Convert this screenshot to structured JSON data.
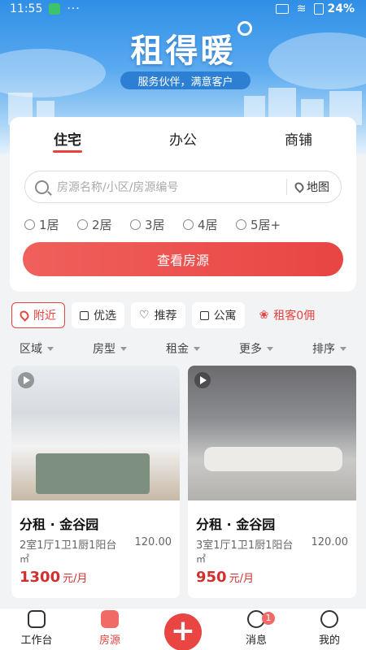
{
  "status_bar": {
    "time": "11:55",
    "dots": "···",
    "battery": "24%"
  },
  "brand": {
    "name": "租得暖",
    "slogan": "服务伙伴，满意客户"
  },
  "tabs": [
    {
      "label": "住宅",
      "active": true
    },
    {
      "label": "办公",
      "active": false
    },
    {
      "label": "商铺",
      "active": false
    }
  ],
  "search": {
    "placeholder": "房源名称/小区/房源编号",
    "map_label": "地图"
  },
  "room_options": [
    "1居",
    "2居",
    "3居",
    "4居",
    "5居+"
  ],
  "cta_label": "查看房源",
  "chips": [
    {
      "label": "附近",
      "icon": "location-pin-icon",
      "active": true
    },
    {
      "label": "优选",
      "icon": "gift-icon",
      "active": false
    },
    {
      "label": "推荐",
      "icon": "heart-icon",
      "active": false
    },
    {
      "label": "公寓",
      "icon": "building-icon",
      "active": false
    },
    {
      "label": "租客0佣",
      "icon": "money-bag-icon",
      "active": false
    }
  ],
  "filters": [
    "区域",
    "房型",
    "租金",
    "更多",
    "排序"
  ],
  "listings": [
    {
      "title": "分租 · 金谷园",
      "spec": "2室1厅1卫1厨1阳台",
      "area": "120.00",
      "unit": "㎡",
      "price": "1300",
      "price_unit": "元/月"
    },
    {
      "title": "分租 · 金谷园",
      "spec": "3室1厅1卫1厨1阳台",
      "area": "120.00",
      "unit": "㎡",
      "price": "950",
      "price_unit": "元/月"
    }
  ],
  "bottom_nav": [
    {
      "label": "工作台",
      "icon": "workbench-icon",
      "active": false
    },
    {
      "label": "房源",
      "icon": "house-listing-icon",
      "active": true
    },
    {
      "label": "",
      "icon": "plus-icon",
      "active": false
    },
    {
      "label": "消息",
      "icon": "planet-message-icon",
      "active": false,
      "badge": "1"
    },
    {
      "label": "我的",
      "icon": "smiley-profile-icon",
      "active": false
    }
  ],
  "colors": {
    "accent": "#e8413e",
    "banner": "#3a92e6"
  }
}
